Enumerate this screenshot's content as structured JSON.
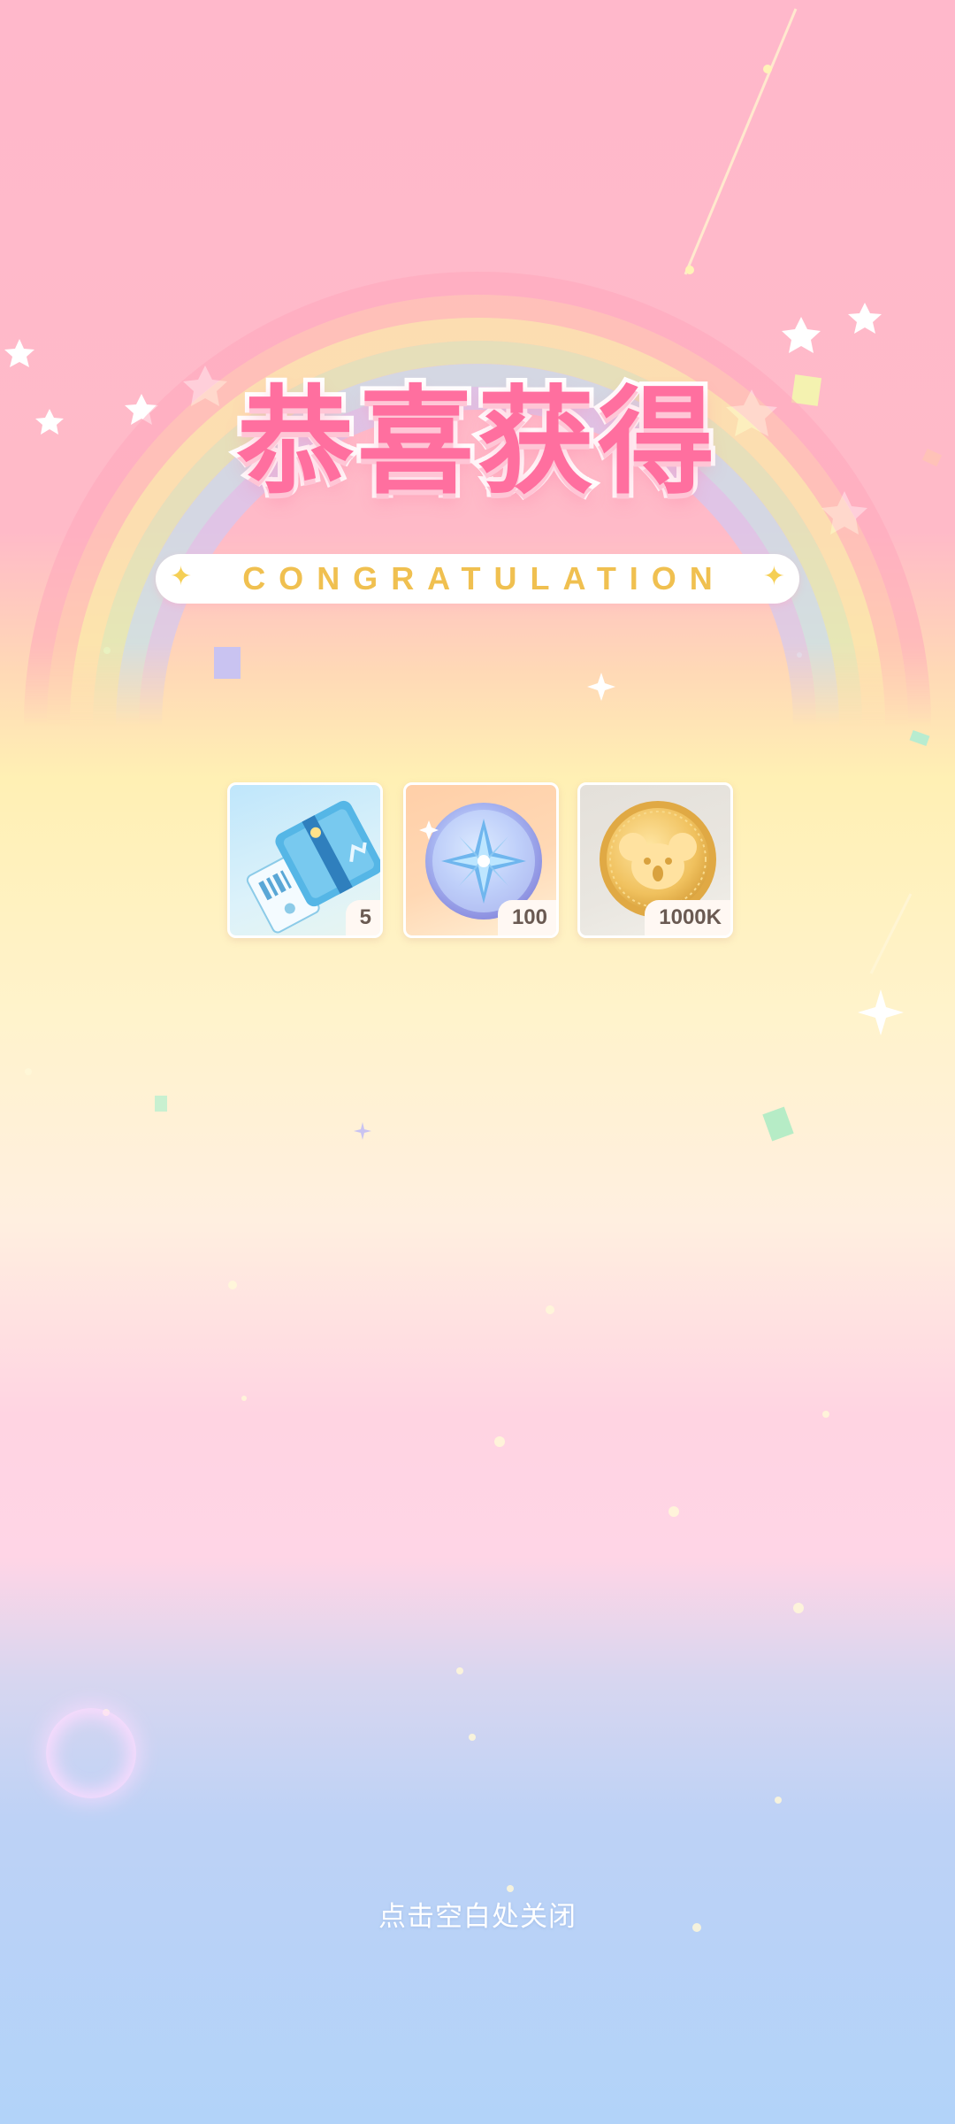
{
  "header": {
    "title": "恭喜获得",
    "subtitle": "CONGRATULATION"
  },
  "rewards": [
    {
      "icon": "ticket-icon",
      "quantity": "5"
    },
    {
      "icon": "compass-star-token-icon",
      "quantity": "100"
    },
    {
      "icon": "koala-gold-coin-icon",
      "quantity": "1000K"
    }
  ],
  "footer": {
    "close_hint": "点击空白处关闭"
  },
  "colors": {
    "title": "#ff6f9f",
    "subtitle": "#f0c050",
    "background_top": "#ffb8cb",
    "background_bottom": "#b2d3f9"
  }
}
